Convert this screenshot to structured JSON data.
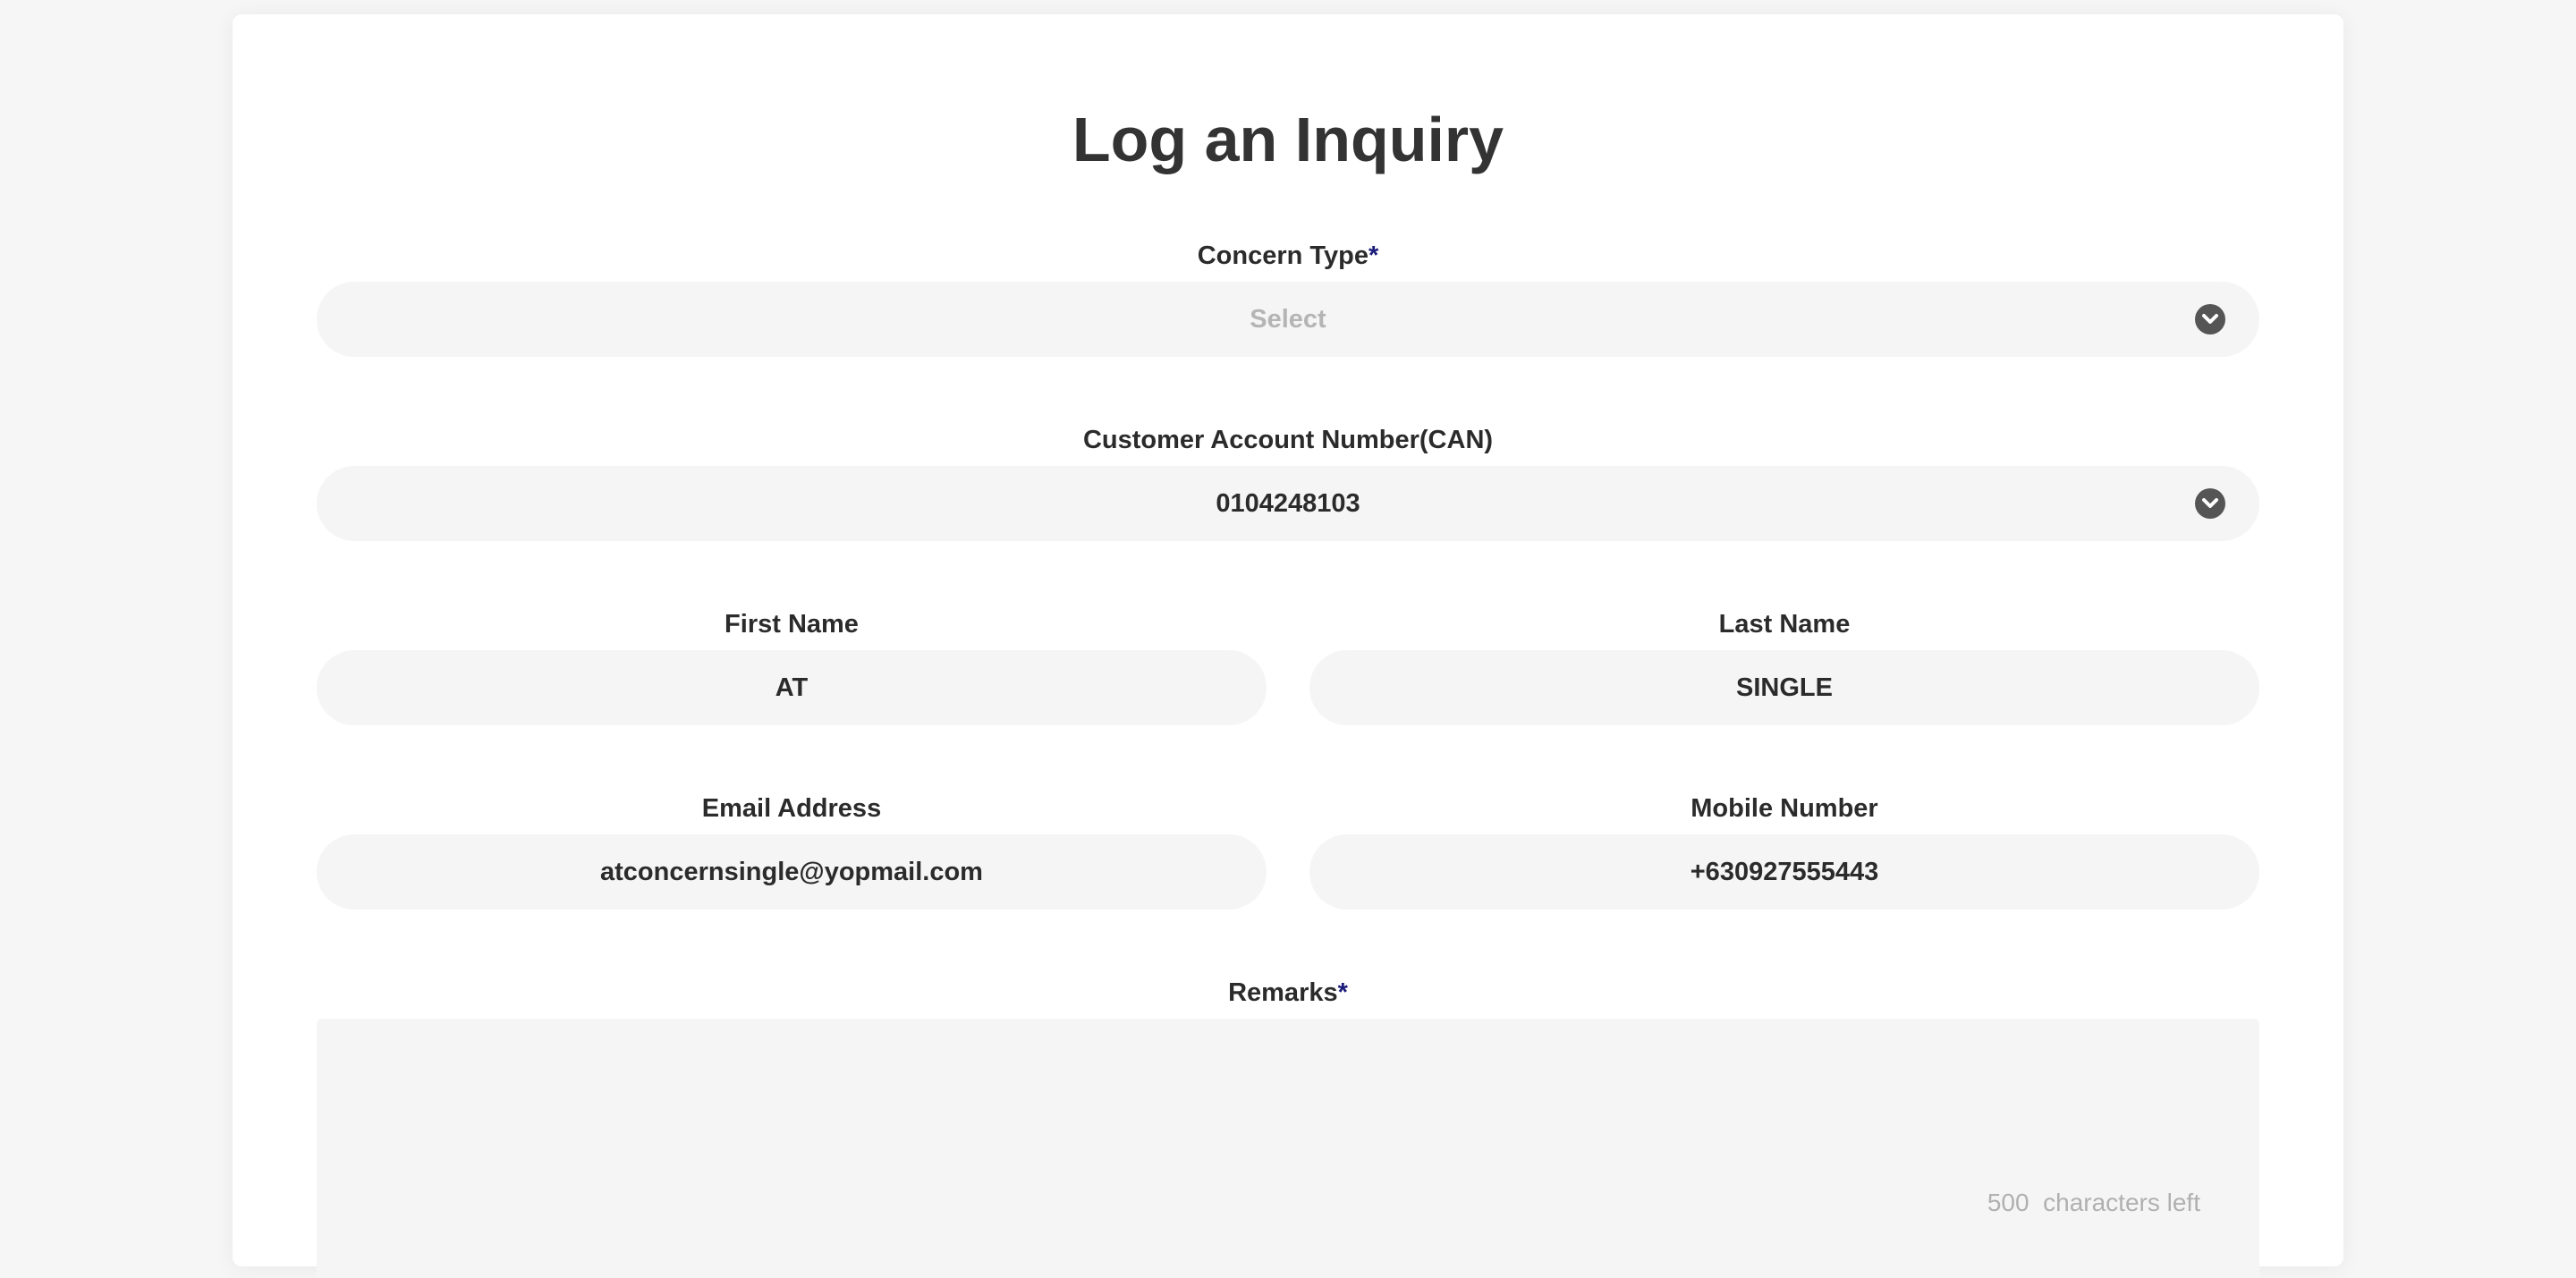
{
  "form": {
    "title": "Log an Inquiry",
    "concern_type": {
      "label": "Concern Type",
      "required_mark": "*",
      "placeholder": "Select"
    },
    "can": {
      "label": "Customer Account Number(CAN)",
      "value": "0104248103"
    },
    "first_name": {
      "label": "First Name",
      "value": "AT"
    },
    "last_name": {
      "label": "Last Name",
      "value": "SINGLE"
    },
    "email": {
      "label": "Email Address",
      "value": "atconcernsingle@yopmail.com"
    },
    "mobile": {
      "label": "Mobile Number",
      "value": "+630927555443"
    },
    "remarks": {
      "label": "Remarks",
      "required_mark": "*",
      "value": "",
      "chars_left": "500",
      "chars_left_suffix": "characters left"
    }
  },
  "icons": {
    "dropdown": "chevron-down-circle-icon"
  }
}
